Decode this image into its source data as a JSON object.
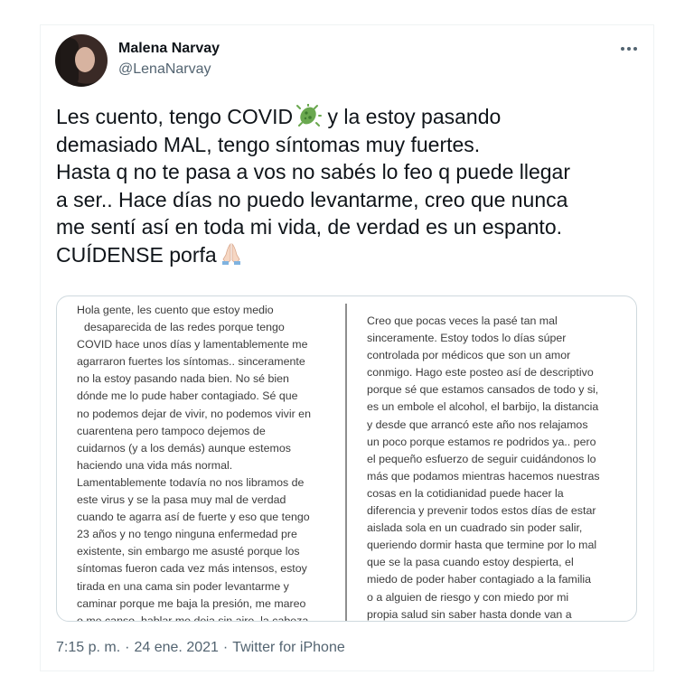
{
  "user": {
    "name": "Malena Narvay",
    "handle": "@LenaNarvay"
  },
  "tweet": {
    "text_part1": "Les cuento, tengo COVID",
    "text_part2": " y la estoy pasando\ndemasiado MAL, tengo síntomas muy fuertes.\nHasta q no te pasa a vos no sabés lo feo q puede llegar\na ser.. Hace días no puedo levantarme, creo que nunca\nme sentí así en toda mi vida, de verdad es un espanto.\nCUÍDENSE porfa",
    "emoji_1": "microbe-icon",
    "emoji_2": "folded-hands-icon"
  },
  "media": {
    "left_lines": [
      "Hola gente, les cuento que estoy medio",
      "desaparecida de las redes porque tengo",
      "COVID hace unos días y lamentablemente me",
      "agarraron fuertes los síntomas.. sinceramente",
      "no la estoy pasando nada bien. No sé bien",
      "dónde me lo pude haber contagiado. Sé que",
      "no podemos dejar de vivir, no podemos vivir en",
      "cuarentena  pero tampoco dejemos de",
      "cuidarnos (y a los demás) aunque estemos",
      "haciendo una vida más normal.",
      "Lamentablemente todavía no nos libramos de",
      "este virus y se la pasa muy mal de verdad",
      "cuando te agarra así de fuerte y eso que tengo",
      "23 años y no tengo ninguna enfermedad pre",
      "existente, sin embargo me asusté porque los",
      "síntomas fueron cada vez más intensos, estoy",
      "tirada en una cama sin poder levantarme y",
      "caminar porque me baja la presión, me mareo",
      "o me canso, hablar me deja sin aire, la cabeza"
    ],
    "right_lines": [
      "Creo que pocas veces la pasé tan mal",
      "sinceramente. Estoy todos lo días súper",
      "controlada por médicos que son un amor",
      "conmigo. Hago este posteo así de descriptivo",
      "porque sé que estamos cansados de todo y si,",
      "es un embole el alcohol, el barbijo, la distancia",
      "y desde que arrancó este año nos relajamos",
      "un poco porque estamos re podridos ya.. pero",
      "el pequeño esfuerzo de seguir cuidándonos lo",
      "más que podamos mientras hacemos nuestras",
      "cosas en la cotidianidad puede hacer la",
      "diferencia y prevenir todos estos días de estar",
      "aislada sola en un cuadrado sin poder salir,",
      "queriendo dormir hasta que termine por lo mal",
      "que se la pasa cuando estoy despierta, el",
      "miedo de poder haber contagiado a la familia",
      "o a alguien de riesgo y con miedo por mi",
      "propia salud sin saber hasta donde van a"
    ]
  },
  "meta": {
    "time": "7:15 p. m.",
    "separator": "·",
    "date": "24 ene. 2021",
    "source": "Twitter for iPhone"
  },
  "colors": {
    "text": "#0f1419",
    "secondary": "#536471",
    "border": "#cfd9de"
  }
}
